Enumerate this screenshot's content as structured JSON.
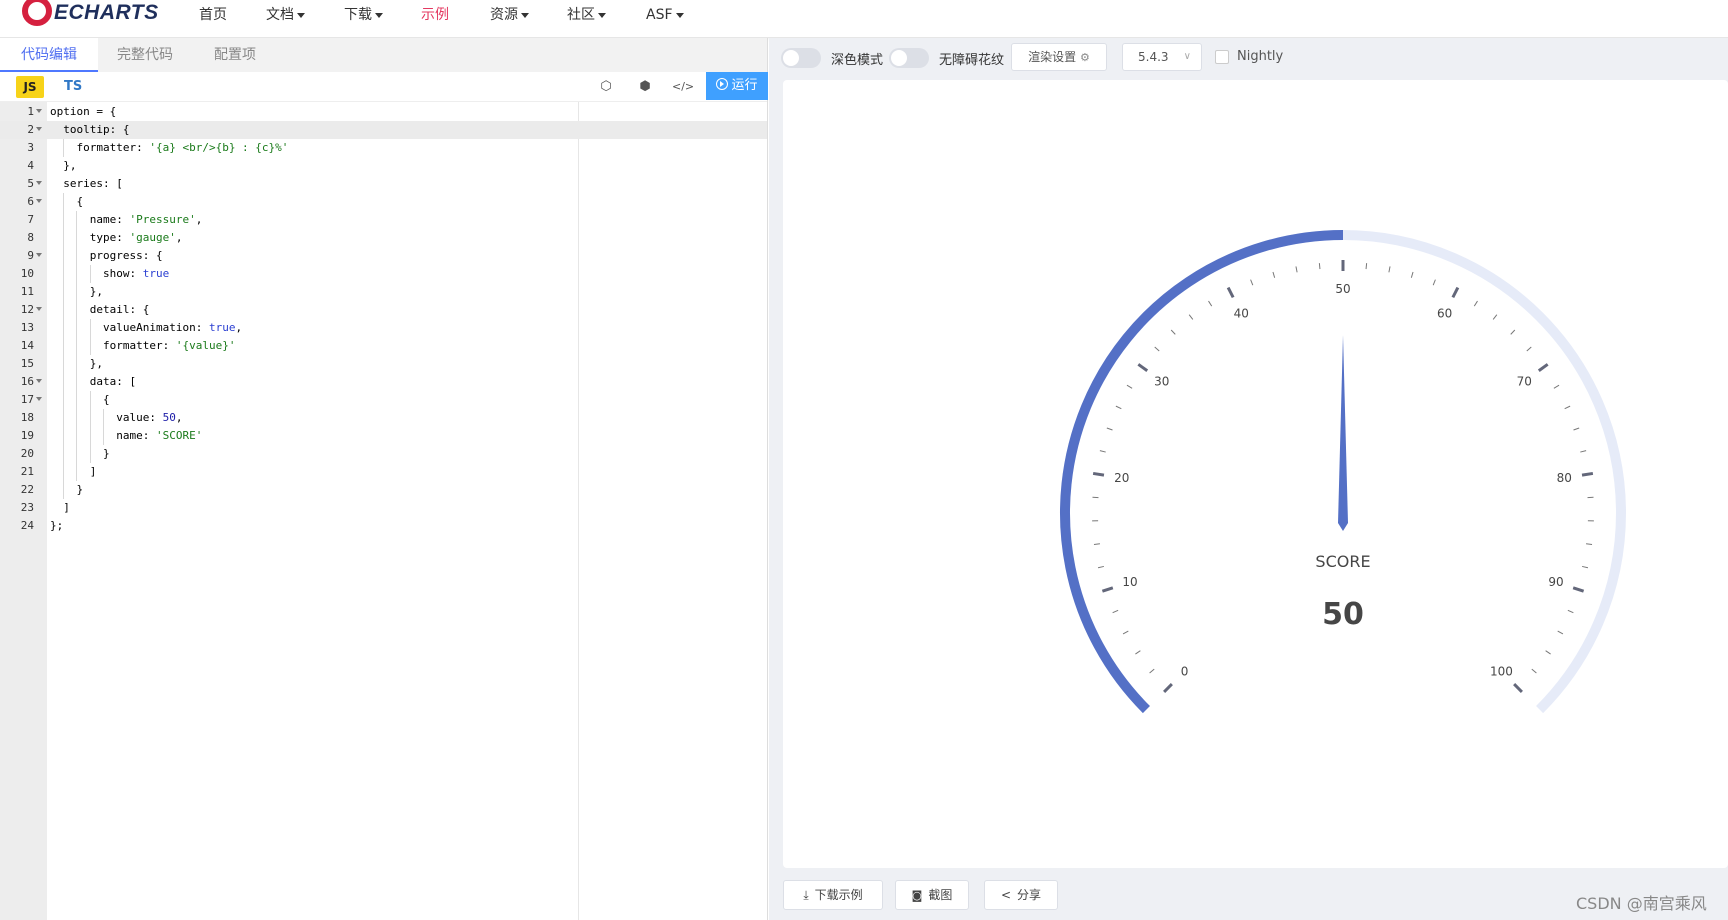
{
  "nav": {
    "logo_text": "ECHARTS",
    "items": [
      {
        "label": "首页",
        "dropdown": false,
        "active": false
      },
      {
        "label": "文档",
        "dropdown": true,
        "active": false
      },
      {
        "label": "下载",
        "dropdown": true,
        "active": false
      },
      {
        "label": "示例",
        "dropdown": false,
        "active": true
      },
      {
        "label": "资源",
        "dropdown": true,
        "active": false
      },
      {
        "label": "社区",
        "dropdown": true,
        "active": false
      },
      {
        "label": "ASF",
        "dropdown": true,
        "active": false
      }
    ],
    "active_color": "#e43961"
  },
  "editor": {
    "tabs": [
      {
        "label": "代码编辑",
        "active": true
      },
      {
        "label": "完整代码",
        "active": false
      },
      {
        "label": "配置项",
        "active": false
      }
    ],
    "lang_js": "JS",
    "lang_ts": "TS",
    "tools": [
      {
        "name": "codepen-icon",
        "glyph": "⬡"
      },
      {
        "name": "codesandbox-icon",
        "glyph": "⬢"
      },
      {
        "name": "code-icon",
        "glyph": "</>"
      }
    ],
    "run_label": "运行",
    "active_line": 2,
    "lines": [
      "option = {",
      "  tooltip: {",
      "    formatter: '{a} <br/>{b} : {c}%'",
      "  },",
      "  series: [",
      "    {",
      "      name: 'Pressure',",
      "      type: 'gauge',",
      "      progress: {",
      "        show: true",
      "      },",
      "      detail: {",
      "        valueAnimation: true,",
      "        formatter: '{value}'",
      "      },",
      "      data: [",
      "        {",
      "          value: 50,",
      "          name: 'SCORE'",
      "        }",
      "      ]",
      "    }",
      "  ]",
      "};"
    ],
    "foldable_lines": [
      1,
      2,
      5,
      6,
      9,
      12,
      16,
      17
    ]
  },
  "controls": {
    "dark_mode_label": "深色模式",
    "a11y_label": "无障碍花纹",
    "render_settings_label": "渲染设置",
    "version": "5.4.3",
    "nightly_label": "Nightly"
  },
  "chart_data": {
    "type": "gauge",
    "min": 0,
    "max": 100,
    "value": 50,
    "name": "SCORE",
    "detail": "50",
    "axis_labels": [
      "0",
      "10",
      "20",
      "30",
      "40",
      "50",
      "60",
      "70",
      "80",
      "90",
      "100"
    ],
    "progress_color": "#5470c6",
    "track_color": "#e6ebf8"
  },
  "footer": {
    "download_label": "下载示例",
    "screenshot_label": "截图",
    "share_label": "分享",
    "watermark": "CSDN @南宫乘风"
  }
}
